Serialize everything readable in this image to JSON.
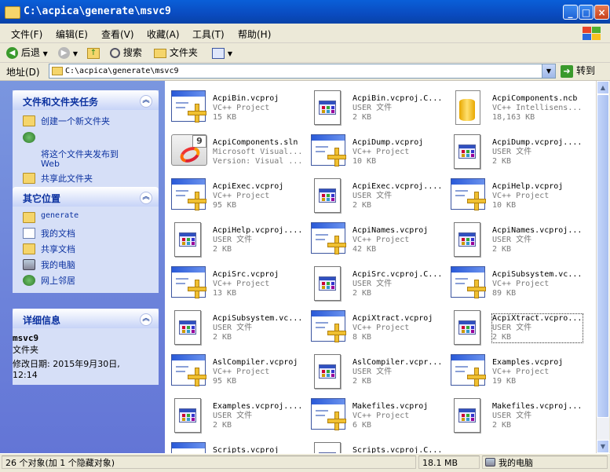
{
  "window": {
    "title": "C:\\acpica\\generate\\msvc9",
    "minimize_icon": "minimize-icon",
    "maximize_icon": "maximize-icon",
    "close_icon": "close-icon"
  },
  "menu": {
    "items": [
      "文件(F)",
      "编辑(E)",
      "查看(V)",
      "收藏(A)",
      "工具(T)",
      "帮助(H)"
    ]
  },
  "toolbar": {
    "back_label": "后退",
    "search_label": "搜索",
    "folders_label": "文件夹"
  },
  "address": {
    "label": "地址(D)",
    "value": "C:\\acpica\\generate\\msvc9",
    "go_label": "转到"
  },
  "tasks": {
    "file_tasks": {
      "title": "文件和文件夹任务",
      "items": [
        "创建一个新文件夹",
        "将这个文件夹发布到\nWeb",
        "共享此文件夹"
      ]
    },
    "other_places": {
      "title": "其它位置",
      "items": [
        "generate",
        "我的文档",
        "共享文档",
        "我的电脑",
        "网上邻居"
      ]
    },
    "details": {
      "title": "详细信息",
      "name": "msvc9",
      "type": "文件夹",
      "modified": "修改日期: 2015年9月30日,\n12:14"
    }
  },
  "files": [
    {
      "name": "AcpiBin.vcproj",
      "type": "VC++ Project",
      "size": "15 KB",
      "icon": "vcproj"
    },
    {
      "name": "AcpiBin.vcproj.C...",
      "type": "USER 文件",
      "size": "2 KB",
      "icon": "user"
    },
    {
      "name": "AcpiComponents.ncb",
      "type": "VC++ Intellisens...",
      "size": "18,163 KB",
      "icon": "ncb"
    },
    {
      "name": "AcpiComponents.sln",
      "type": "Microsoft Visual...",
      "size": "Version: Visual ...",
      "icon": "sln"
    },
    {
      "name": "AcpiDump.vcproj",
      "type": "VC++ Project",
      "size": "10 KB",
      "icon": "vcproj"
    },
    {
      "name": "AcpiDump.vcproj....",
      "type": "USER 文件",
      "size": "2 KB",
      "icon": "user"
    },
    {
      "name": "AcpiExec.vcproj",
      "type": "VC++ Project",
      "size": "95 KB",
      "icon": "vcproj"
    },
    {
      "name": "AcpiExec.vcproj....",
      "type": "USER 文件",
      "size": "2 KB",
      "icon": "user"
    },
    {
      "name": "AcpiHelp.vcproj",
      "type": "VC++ Project",
      "size": "10 KB",
      "icon": "vcproj"
    },
    {
      "name": "AcpiHelp.vcproj....",
      "type": "USER 文件",
      "size": "2 KB",
      "icon": "user"
    },
    {
      "name": "AcpiNames.vcproj",
      "type": "VC++ Project",
      "size": "42 KB",
      "icon": "vcproj"
    },
    {
      "name": "AcpiNames.vcproj...",
      "type": "USER 文件",
      "size": "2 KB",
      "icon": "user"
    },
    {
      "name": "AcpiSrc.vcproj",
      "type": "VC++ Project",
      "size": "13 KB",
      "icon": "vcproj"
    },
    {
      "name": "AcpiSrc.vcproj.C...",
      "type": "USER 文件",
      "size": "2 KB",
      "icon": "user"
    },
    {
      "name": "AcpiSubsystem.vc...",
      "type": "VC++ Project",
      "size": "89 KB",
      "icon": "vcproj"
    },
    {
      "name": "AcpiSubsystem.vc...",
      "type": "USER 文件",
      "size": "2 KB",
      "icon": "user"
    },
    {
      "name": "AcpiXtract.vcproj",
      "type": "VC++ Project",
      "size": "8 KB",
      "icon": "vcproj"
    },
    {
      "name": "AcpiXtract.vcpro...",
      "type": "USER 文件",
      "size": "2 KB",
      "icon": "user",
      "selected": true
    },
    {
      "name": "AslCompiler.vcproj",
      "type": "VC++ Project",
      "size": "95 KB",
      "icon": "vcproj"
    },
    {
      "name": "AslCompiler.vcpr...",
      "type": "USER 文件",
      "size": "2 KB",
      "icon": "user"
    },
    {
      "name": "Examples.vcproj",
      "type": "VC++ Project",
      "size": "19 KB",
      "icon": "vcproj"
    },
    {
      "name": "Examples.vcproj....",
      "type": "USER 文件",
      "size": "2 KB",
      "icon": "user"
    },
    {
      "name": "Makefiles.vcproj",
      "type": "VC++ Project",
      "size": "6 KB",
      "icon": "vcproj"
    },
    {
      "name": "Makefiles.vcproj...",
      "type": "USER 文件",
      "size": "2 KB",
      "icon": "user"
    },
    {
      "name": "Scripts.vcproj",
      "type": "",
      "size": "",
      "icon": "vcproj"
    },
    {
      "name": "Scripts.vcproj.C...",
      "type": "",
      "size": "",
      "icon": "user"
    }
  ],
  "status": {
    "objects": "26 个对象(加 1 个隐藏对象)",
    "size": "18.1 MB",
    "location": "我的电脑"
  }
}
